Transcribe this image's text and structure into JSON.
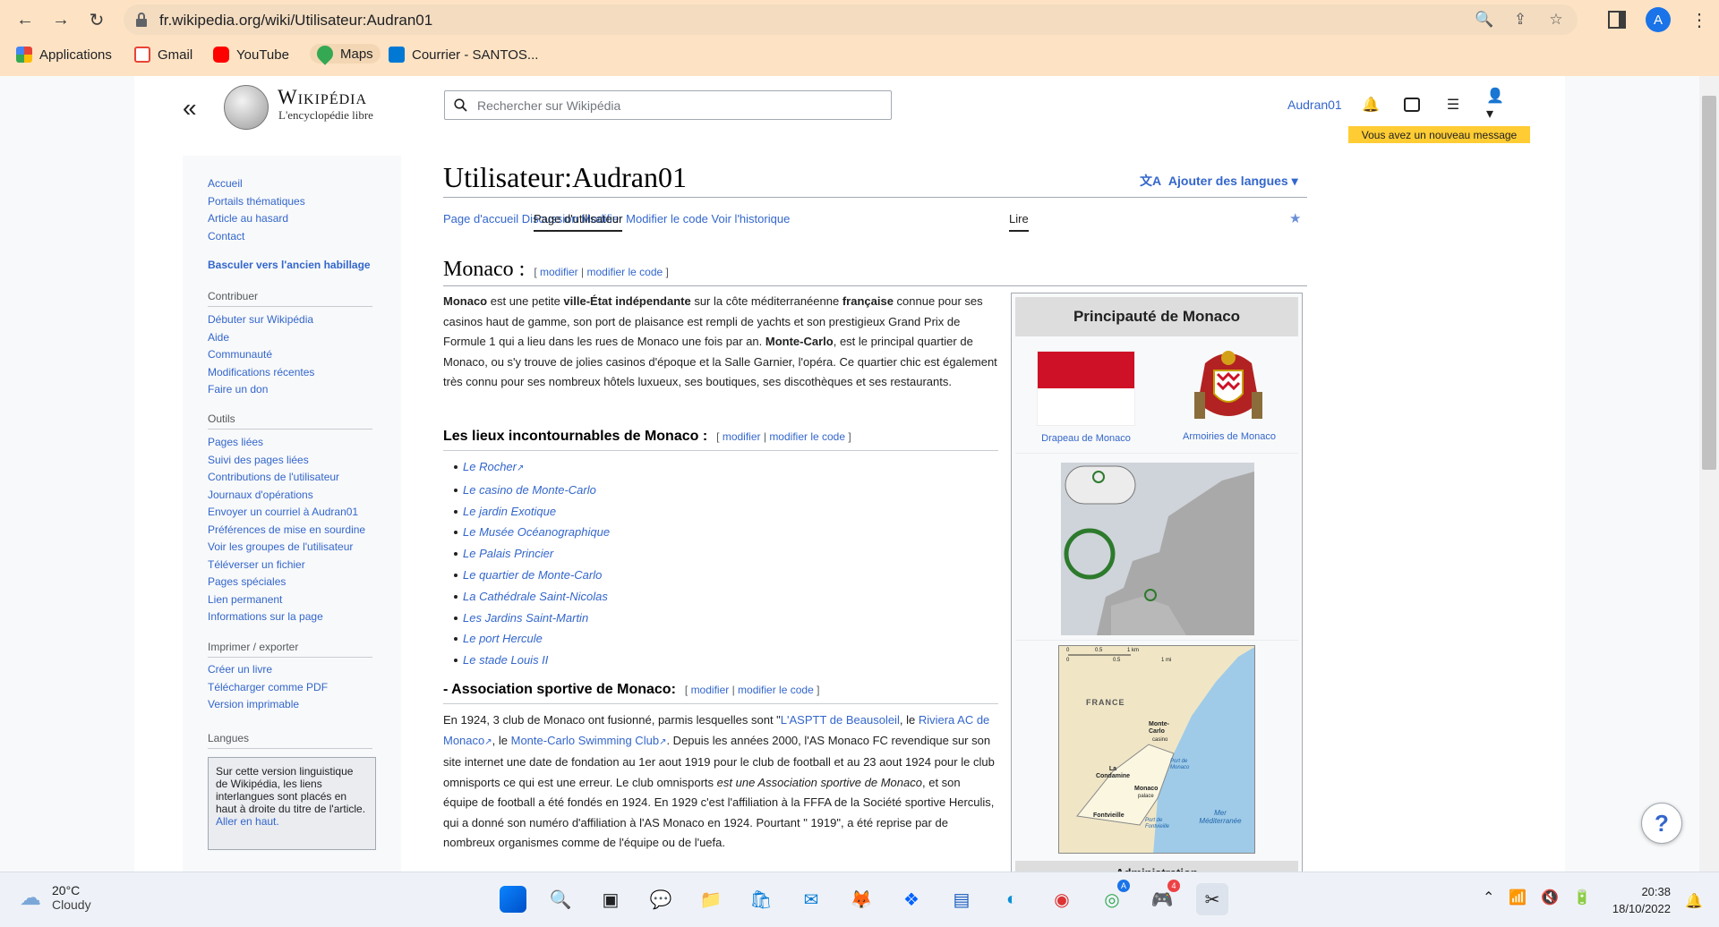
{
  "browser": {
    "url": "fr.wikipedia.org/wiki/Utilisateur:Audran01",
    "profile_initial": "A",
    "bookmarks": [
      {
        "label": "Applications",
        "icon": "apps-grid-icon",
        "color": "#ea4335"
      },
      {
        "label": "Gmail",
        "icon": "gmail-icon",
        "color": "#ea4335"
      },
      {
        "label": "YouTube",
        "icon": "youtube-icon",
        "color": "#ff0000"
      },
      {
        "label": "Maps",
        "icon": "maps-icon",
        "color": "#34a853"
      },
      {
        "label": "Courrier - SANTOS...",
        "icon": "outlook-icon",
        "color": "#0078d4"
      }
    ]
  },
  "header": {
    "logo_word": "Wikipédia",
    "logo_tagline": "L'encyclopédie libre",
    "search_placeholder": "Rechercher sur Wikipédia",
    "username": "Audran01",
    "new_message": "Vous avez un nouveau message"
  },
  "sidebar": {
    "nav": [
      "Accueil",
      "Portails thématiques",
      "Article au hasard",
      "Contact"
    ],
    "switch_skin": "Basculer vers l'ancien habillage",
    "contribute_head": "Contribuer",
    "contribute": [
      "Débuter sur Wikipédia",
      "Aide",
      "Communauté",
      "Modifications récentes",
      "Faire un don"
    ],
    "tools_head": "Outils",
    "tools": [
      "Pages liées",
      "Suivi des pages liées",
      "Contributions de l'utilisateur",
      "Journaux d'opérations",
      "Envoyer un courriel à Audran01",
      "Préférences de mise en sourdine",
      "Voir les groupes de l'utilisateur",
      "Téléverser un fichier",
      "Pages spéciales",
      "Lien permanent",
      "Informations sur la page"
    ],
    "export_head": "Imprimer / exporter",
    "export": [
      "Créer un livre",
      "Télécharger comme PDF",
      "Version imprimable"
    ],
    "lang_head": "Langues",
    "lang_note": "Sur cette version linguistique de Wikipédia, les liens interlangues sont placés en haut à droite du titre de l'article.",
    "lang_link": "Aller en haut."
  },
  "page": {
    "title": "Utilisateur:Audran01",
    "add_languages": "Ajouter des langues",
    "tabs_left": [
      "Page d'accueil",
      "Page d'utilisateur",
      "Discussion"
    ],
    "tabs_right": [
      "Lire",
      "Modifier",
      "Modifier le code",
      "Voir l'historique"
    ],
    "edit_label": "modifier",
    "edit_code_label": "modifier le code",
    "h2": "Monaco :",
    "intro_parts": {
      "b1": "Monaco",
      "t1": " est une petite ",
      "b2": "ville-État indépendante",
      "t2": " sur la côte méditerranéenne ",
      "b3": "française",
      "t3": " connue pour ses casinos haut de gamme, son port de plaisance est rempli de yachts et son prestigieux Grand Prix de Formule 1 qui a lieu dans les rues de Monaco une fois par an. ",
      "b4": "Monte-Carlo",
      "t4": ", est le principal quartier de Monaco, ou s'y trouve de jolies casinos d'époque et la Salle Garnier, l'opéra. Ce quartier chic est également très connu pour ses nombreux hôtels luxueux, ses boutiques, ses discothèques et ses restaurants."
    },
    "h3_places": "Les lieux incontournables de Monaco :",
    "places": [
      "Le Rocher",
      "Le casino de Monte-Carlo",
      "Le jardin Exotique",
      "Le Musée Océanographique",
      "Le Palais Princier",
      "Le quartier de Monte-Carlo",
      "La Cathédrale Saint-Nicolas",
      "Les Jardins Saint-Martin",
      "Le port Hercule",
      "Le stade Louis II"
    ],
    "h3_sport": "- Association sportive de Monaco:",
    "sport_parts": {
      "t1": "En 1924, 3 club de Monaco ont fusionné, parmis lesquelles sont \"",
      "l1": "L'ASPTT de Beausoleil",
      "t2": ", le ",
      "l2": "Riviera AC de Monaco",
      "t3": ", le ",
      "l3": "Monte-Carlo Swimming Club",
      "t4": ". Depuis les années 2000, l'AS Monaco FC revendique sur son site internet une date de fondation au 1er aout 1919 pour le club de football et au 23 aout 1924 pour le club omnisports ce qui est une erreur. Le club omnisports ",
      "i1": "est une Association sportive de Monaco",
      "t5": ", et son équipe de football a été fondés en 1924. En 1929 c'est l'affiliation à la FFFA de la Société sportive Herculis, qui a donné son numéro d'affiliation à l'AS Monaco en 1924. Pourtant \" 1919\", a été reprise par de nombreux organismes comme de l'équipe ou de l'uefa."
    }
  },
  "infobox": {
    "title": "Principauté de Monaco",
    "flag_caption": "Drapeau de Monaco",
    "arms_caption": "Armoiries de Monaco",
    "map_labels": {
      "france": "FRANCE",
      "monte_carlo": "Monte-Carlo",
      "casino": "casino",
      "la_condamine": "La Condamine",
      "monaco": "Monaco",
      "palace": "palace",
      "fontvieille": "Fontvieille",
      "port_monaco": "Port de Monaco",
      "port_fontvieille": "Port de Fontvieille",
      "sea": "Mer Méditerranée",
      "scale_km": "1 km",
      "scale_mi": "1 mi",
      "scale_0": "0",
      "scale_05": "0.5"
    },
    "section_admin": "Administration"
  },
  "help_label": "?",
  "taskbar": {
    "temp": "20°C",
    "weather": "Cloudy",
    "time": "20:38",
    "date": "18/10/2022",
    "badge_chrome": "A",
    "badge_discord": "4"
  }
}
